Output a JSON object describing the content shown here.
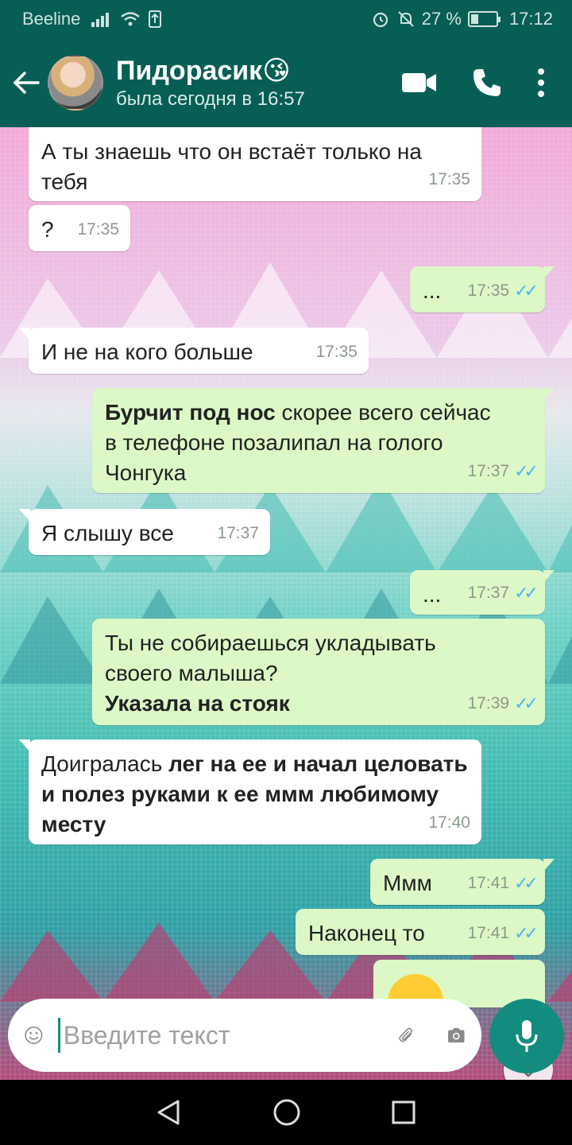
{
  "status_bar": {
    "carrier": "Beeline",
    "battery_percent": "27 %",
    "time": "17:12"
  },
  "header": {
    "contact_name": "Пидорасик😘",
    "last_seen": "была сегодня в 16:57"
  },
  "messages": [
    {
      "dir": "in",
      "text": "А ты знаешь что он встаёт только на тебя",
      "time": "17:35"
    },
    {
      "dir": "in",
      "text": "?",
      "time": "17:35"
    },
    {
      "dir": "out",
      "text": "...",
      "time": "17:35",
      "read": true
    },
    {
      "dir": "in",
      "text": "И не на кого  больше",
      "time": "17:35"
    },
    {
      "dir": "out",
      "bold": "Бурчит под нос",
      "text": " скорее всего сейчас в телефоне позалипал на голого Чонгука",
      "time": "17:37",
      "read": true
    },
    {
      "dir": "in",
      "text": "Я слышу все",
      "time": "17:37"
    },
    {
      "dir": "out",
      "text": "...",
      "time": "17:37",
      "read": true
    },
    {
      "dir": "out",
      "text": "Ты не собираешься укладывать своего малыша?",
      "bold": " Указала на стояк",
      "time": "17:39",
      "read": true
    },
    {
      "dir": "in",
      "text": "Доигралась ",
      "bold": "лег на ее и начал целовать и полез руками к ее ммм любимому месту",
      "time": "17:40"
    },
    {
      "dir": "out",
      "text": "Ммм",
      "time": "17:41",
      "read": true
    },
    {
      "dir": "out",
      "text": "Наконец то",
      "time": "17:41",
      "read": true
    }
  ],
  "input": {
    "placeholder": "Введите текст"
  },
  "colors": {
    "header": "#075e54",
    "incoming_bubble": "#ffffff",
    "outgoing_bubble": "#dcf8c6",
    "read_ticks": "#4fb3f6",
    "accent": "#128c7e"
  },
  "icons": [
    "back-arrow-icon",
    "video-call-icon",
    "phone-icon",
    "more-icon",
    "emoji-icon",
    "attach-icon",
    "camera-icon",
    "mic-icon",
    "scroll-down-icon",
    "nav-back-icon",
    "nav-home-icon",
    "nav-recents-icon"
  ]
}
